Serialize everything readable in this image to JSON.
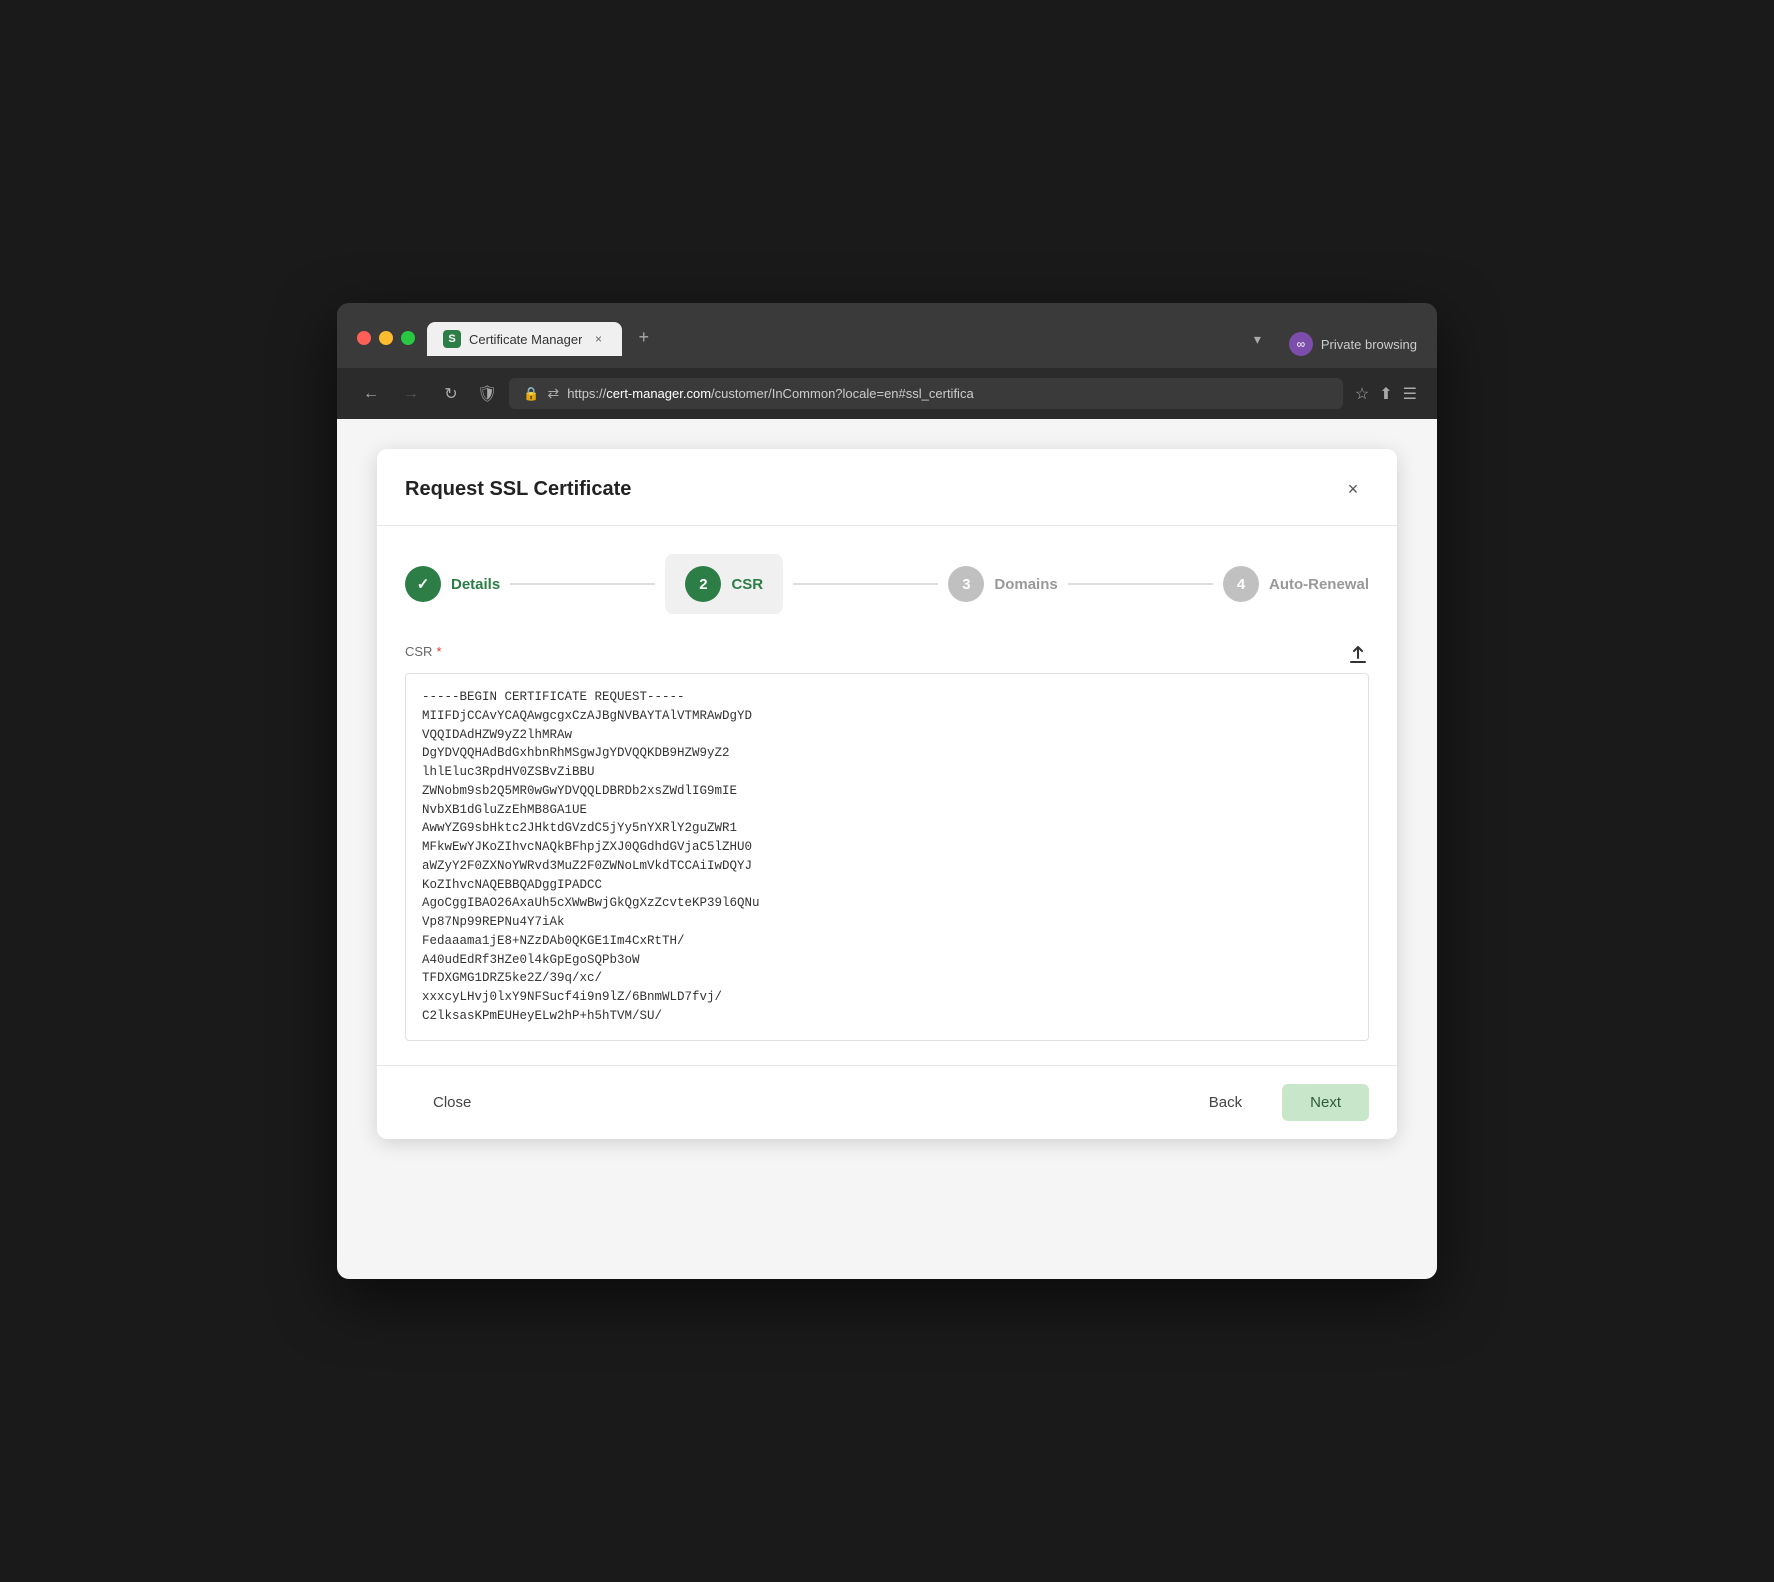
{
  "browser": {
    "tab_title": "Certificate Manager",
    "tab_icon": "S",
    "url_prefix": "https://",
    "url_domain": "cert-manager.com",
    "url_path": "/customer/InCommon?locale=en#ssl_certifica",
    "private_browsing_label": "Private browsing",
    "new_tab_label": "+"
  },
  "dialog": {
    "title": "Request SSL Certificate",
    "close_icon": "×",
    "steps": [
      {
        "id": 1,
        "label": "Details",
        "state": "done",
        "number": "✓"
      },
      {
        "id": 2,
        "label": "CSR",
        "state": "active",
        "number": "2"
      },
      {
        "id": 3,
        "label": "Domains",
        "state": "inactive",
        "number": "3"
      },
      {
        "id": 4,
        "label": "Auto-Renewal",
        "state": "inactive",
        "number": "4"
      }
    ],
    "csr_label": "CSR",
    "csr_required": "*",
    "csr_content": "-----BEGIN CERTIFICATE REQUEST-----\nMIIFDjCCAvYCAQAwgcgxCzAJBgNVBAYTAlVTMRAwDgYD\nVQQIDAdHZW9yZ2lhMRAw\nDgYDVQQHAdBdGxhbnRhMSgwJgYDVQQKDB9HZW9yZ2\nlhlEluc3RpdHV0ZSBvZiBBU\nZWNobm9sb2Q5MR0wGwYDVQQLDBRDb2xsZWdlIG9mIE\nNvbXB1dGluZzEhMB8GA1UE\nAwwYZG9sbHktc2JHktdGVzdC5jYy5nYXRlY2guZWR1\nMFkwEwYJKoZIhvcNAQkBFhpjZXJ0QGdhdGVjaC5lZHU0\naWZyY2F0ZXNoYWRvd3MuZ2F0ZWNoLmVkdTCCAiIwDQYJ\nKoZIhvcNAQEBBQADggIPADCC\nAgoCggIBAO26AxaUh5cXWwBwjGkQgXzZcvteKP39l6QNu\nVp87Np99REPNu4Y7iAk\nFedaaama1jE8+NZzDAb0QKGE1Im4CxRtTH/\nA40udEdRf3HZe0l4kGpEgoSQPb3oW\nTFDXGMG1DRZ5ke2Z/39q/xc/\nxxxcyLHvj0lxY9NFSucf4i9n9lZ/6BnmWLD7fvj/\nC2lksasKPmEUHeyELw2hP+h5hTVM/SU/",
    "footer": {
      "close_label": "Close",
      "back_label": "Back",
      "next_label": "Next"
    }
  }
}
